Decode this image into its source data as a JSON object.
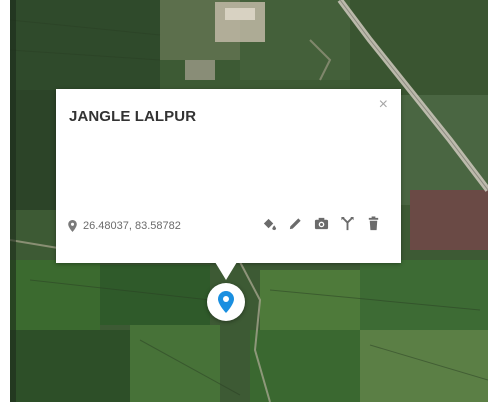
{
  "place": {
    "title": "JANGLE LALPUR",
    "coordinates": "26.48037, 83.58782",
    "close_symbol": "×"
  },
  "actions": [
    {
      "icon": "paint-bucket-icon"
    },
    {
      "icon": "pencil-icon"
    },
    {
      "icon": "camera-icon"
    },
    {
      "icon": "directions-icon"
    },
    {
      "icon": "trash-icon"
    }
  ],
  "colors": {
    "marker": "#1a8fe0",
    "title": "#333333",
    "icons": "#6b6b6b"
  }
}
